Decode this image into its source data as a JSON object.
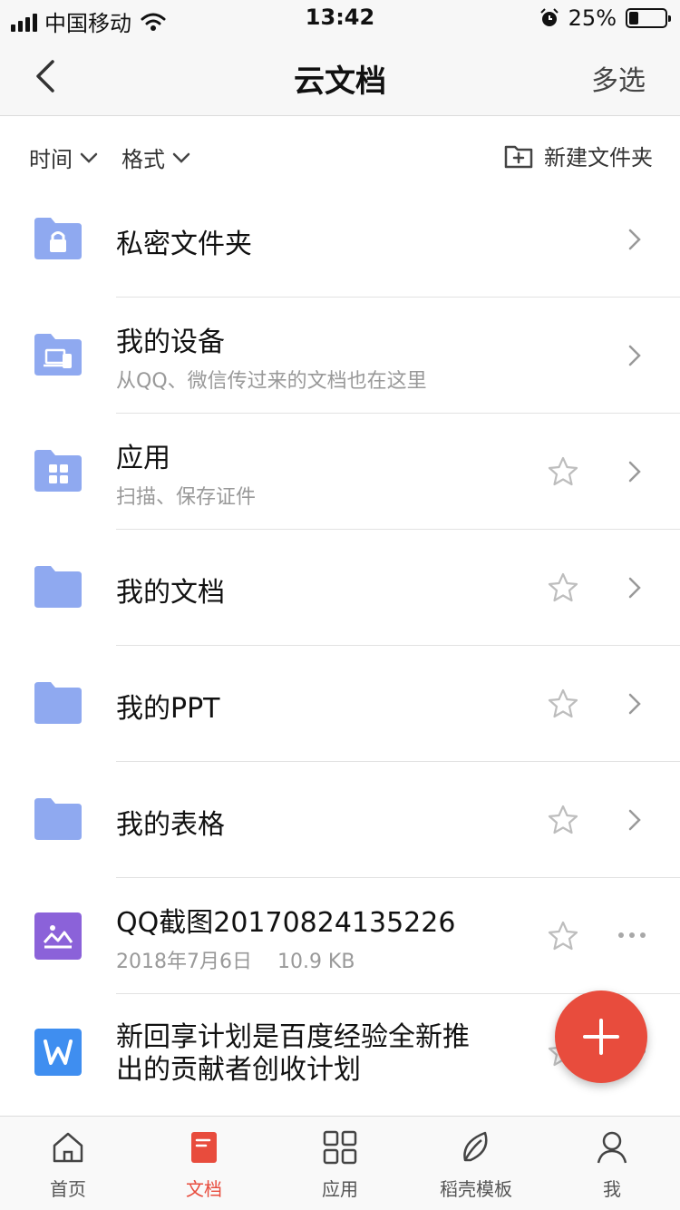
{
  "status": {
    "carrier": "中国移动",
    "time": "13:42",
    "battery_pct": "25%",
    "battery_level": 0.25
  },
  "nav": {
    "title": "云文档",
    "right_action": "多选",
    "back_icon": "chevron-left-icon"
  },
  "filters": {
    "time_label": "时间",
    "format_label": "格式",
    "new_folder_label": "新建文件夹"
  },
  "items": [
    {
      "title": "私密文件夹",
      "subtitle": "",
      "icon": "lock-folder-icon",
      "starrable": false,
      "trailing": "chevron"
    },
    {
      "title": "我的设备",
      "subtitle": "从QQ、微信传过来的文档也在这里",
      "icon": "device-folder-icon",
      "starrable": false,
      "trailing": "chevron"
    },
    {
      "title": "应用",
      "subtitle": "扫描、保存证件",
      "icon": "app-folder-icon",
      "starrable": true,
      "trailing": "chevron"
    },
    {
      "title": "我的文档",
      "subtitle": "",
      "icon": "folder-icon",
      "starrable": true,
      "trailing": "chevron"
    },
    {
      "title": "我的PPT",
      "subtitle": "",
      "icon": "folder-icon",
      "starrable": true,
      "trailing": "chevron"
    },
    {
      "title": "我的表格",
      "subtitle": "",
      "icon": "folder-icon",
      "starrable": true,
      "trailing": "chevron"
    },
    {
      "title": "QQ截图20170824135226",
      "subtitle": "2018年7月6日    10.9 KB",
      "icon": "image-file-icon",
      "starrable": true,
      "trailing": "more"
    },
    {
      "title_line1": "新回享计划是百度经验全新推",
      "title_line2": "出的贡献者创收计划",
      "icon": "word-file-icon",
      "starrable": true,
      "trailing": "more"
    }
  ],
  "tabs": [
    {
      "label": "首页",
      "icon": "home-icon",
      "active": false
    },
    {
      "label": "文档",
      "icon": "document-icon",
      "active": true
    },
    {
      "label": "应用",
      "icon": "grid-icon",
      "active": false
    },
    {
      "label": "稻壳模板",
      "icon": "leaf-icon",
      "active": false
    },
    {
      "label": "我",
      "icon": "user-icon",
      "active": false
    }
  ],
  "colors": {
    "folder": "#8fa9f0",
    "accent": "#e84c3d",
    "image_file": "#8b62d9",
    "word_file": "#3f8ef0"
  }
}
